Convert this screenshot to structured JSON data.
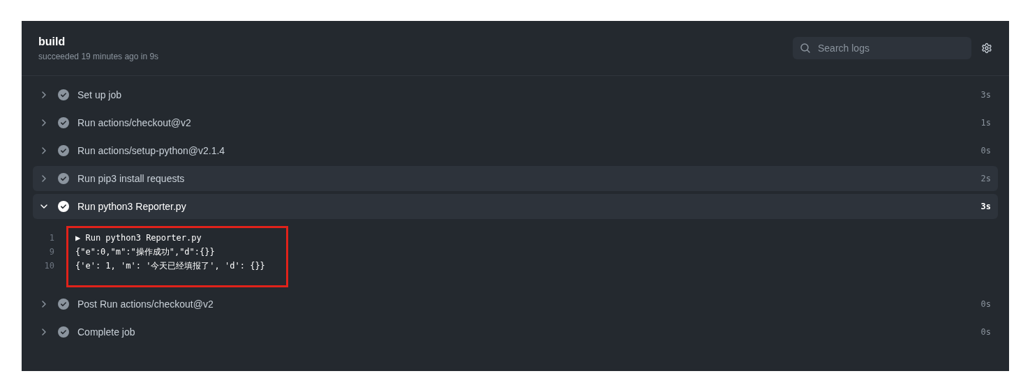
{
  "header": {
    "title": "build",
    "subtitle": "succeeded 19 minutes ago in 9s",
    "search": {
      "placeholder": "Search logs"
    }
  },
  "steps": [
    {
      "name": "Set up job",
      "duration": "3s",
      "expanded": false,
      "hovered": false
    },
    {
      "name": "Run actions/checkout@v2",
      "duration": "1s",
      "expanded": false,
      "hovered": false
    },
    {
      "name": "Run actions/setup-python@v2.1.4",
      "duration": "0s",
      "expanded": false,
      "hovered": false
    },
    {
      "name": "Run pip3 install requests",
      "duration": "2s",
      "expanded": false,
      "hovered": true
    },
    {
      "name": "Run python3 Reporter.py",
      "duration": "3s",
      "expanded": true,
      "hovered": false,
      "log": {
        "annotated": true,
        "lines": [
          {
            "number": "1",
            "text": "▶ Run python3 Reporter.py"
          },
          {
            "number": "9",
            "text": "{\"e\":0,\"m\":\"操作成功\",\"d\":{}}"
          },
          {
            "number": "10",
            "text": "{'e': 1, 'm': '今天已经填报了', 'd': {}}"
          }
        ]
      }
    },
    {
      "name": "Post Run actions/checkout@v2",
      "duration": "0s",
      "expanded": false,
      "hovered": false
    },
    {
      "name": "Complete job",
      "duration": "0s",
      "expanded": false,
      "hovered": false
    }
  ]
}
